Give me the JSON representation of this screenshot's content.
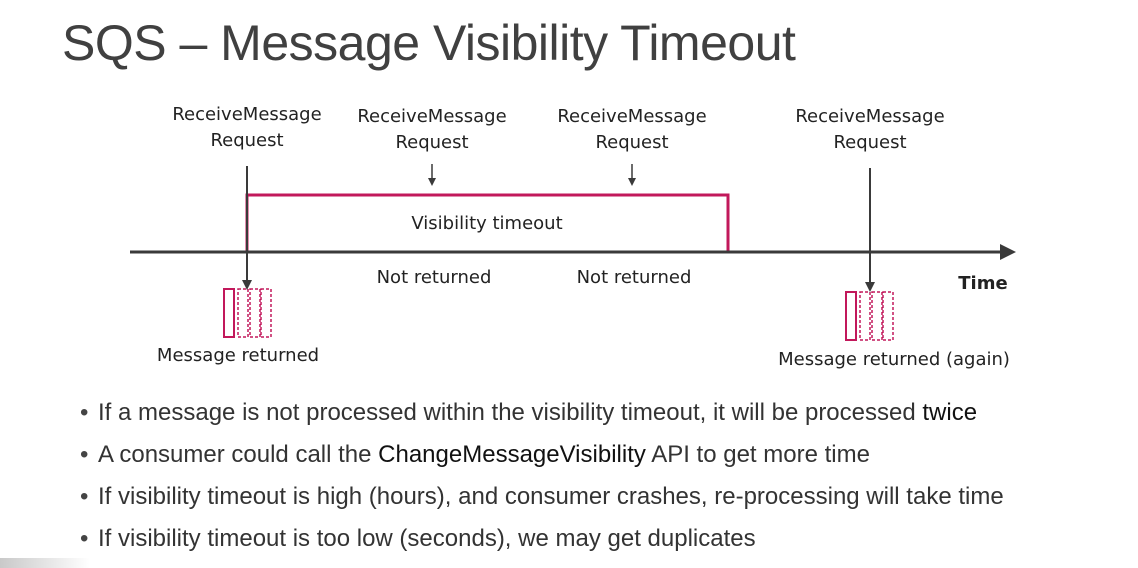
{
  "title": "SQS – Message Visibility Timeout",
  "diagram": {
    "requests": [
      {
        "line1": "ReceiveMessage",
        "line2": "Request"
      },
      {
        "line1": "ReceiveMessage",
        "line2": "Request"
      },
      {
        "line1": "ReceiveMessage",
        "line2": "Request"
      },
      {
        "line1": "ReceiveMessage",
        "line2": "Request"
      }
    ],
    "timeout_label": "Visibility timeout",
    "not_returned_1": "Not returned",
    "not_returned_2": "Not returned",
    "time_label": "Time",
    "returned_1": "Message returned",
    "returned_2": "Message returned (again)",
    "accent_color": "#c2185b"
  },
  "bullets": [
    {
      "pre": "If a message is not processed within the visibility timeout, it will be processed ",
      "term": "twice",
      "post": ""
    },
    {
      "pre": "A consumer could call the ",
      "term": "ChangeMessageVisibility",
      "post": " API to get more time"
    },
    {
      "pre": "If visibility timeout is high (hours), and consumer crashes, re-processing will take time",
      "term": "",
      "post": ""
    },
    {
      "pre": "If visibility timeout is too low (seconds), we may get duplicates",
      "term": "",
      "post": ""
    }
  ]
}
